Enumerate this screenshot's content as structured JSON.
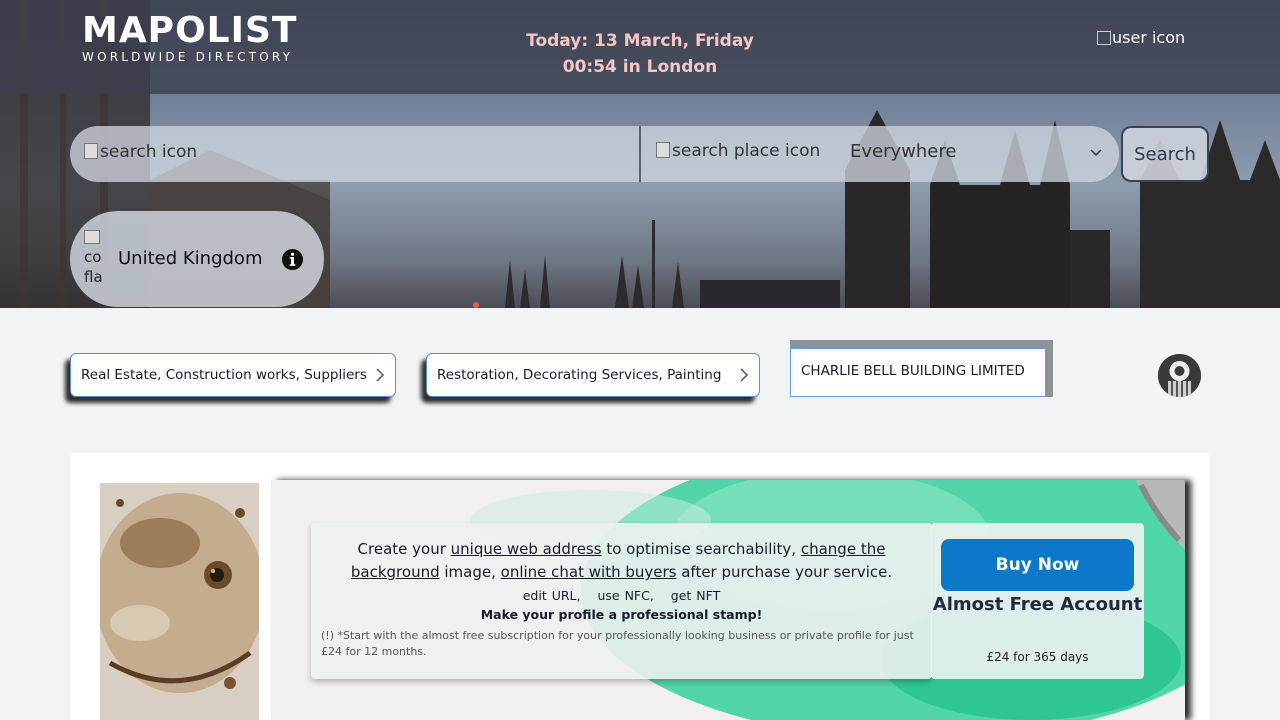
{
  "header": {
    "logo_main": "MAPOLIST",
    "logo_sub": "WORLDWIDE DIRECTORY",
    "date_line": "Today: 13 March, Friday",
    "time_line": "00:54 in London",
    "user_icon_alt": "user icon"
  },
  "search": {
    "search_icon_alt": "search icon",
    "place_icon_alt": "search place icon",
    "location_value": "Everywhere",
    "button_label": "Search"
  },
  "country": {
    "flag_alt": "co fla",
    "name": "United Kingdom"
  },
  "breadcrumb": {
    "category_1": "Real Estate, Construction works, Suppliers",
    "category_2": "Restoration, Decorating Services, Painting",
    "business_name": "CHARLIE BELL BUILDING LIMITED"
  },
  "promo": {
    "text_1": "Create your ",
    "link_1": "unique web address",
    "text_2": " to optimise searchability, ",
    "link_2": "change the background",
    "text_3": " image, ",
    "link_3": "online chat with buyers",
    "text_4": " after purchase your service.",
    "opt_1": "edit URL,",
    "opt_2": "use NFC,",
    "opt_3": "get NFT",
    "bold_line": "Make your profile a professional stamp!",
    "note": "(!) *Start with the almost free subscription for your professionally looking business or private profile for just £24 for 12 months."
  },
  "buy": {
    "button_label": "Buy Now",
    "title": "Almost Free Account",
    "price": "£24 for 365 days"
  },
  "colors": {
    "accent": "#0b78c9",
    "date_text": "#f3c7c7"
  }
}
